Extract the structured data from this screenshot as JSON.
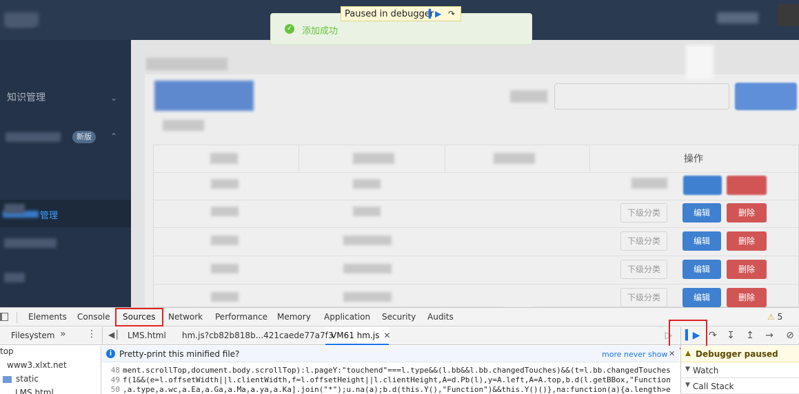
{
  "sidebar": {
    "knowledge_label": "知识管理",
    "new_tag": "新版",
    "sub_label": "管理"
  },
  "toast": {
    "message": "添加成功"
  },
  "debugger_banner": {
    "text": "Paused in debugger"
  },
  "table": {
    "op_header": "操作",
    "sub_button": "下级分类",
    "edit_button": "编辑",
    "delete_button": "删除"
  },
  "devtools": {
    "tabs": [
      "Elements",
      "Console",
      "Sources",
      "Network",
      "Performance",
      "Memory",
      "Application",
      "Security",
      "Audits"
    ],
    "warnings": "5",
    "filesystem_label": "Filesystem",
    "file_tabs": [
      "LMS.html",
      "hm.js?cb82b818b...421caede77a7f3",
      "VM61 hm.js"
    ],
    "tree": [
      "top",
      "www3.xlxt.net",
      "static",
      "LMS.html"
    ],
    "pretty_print": {
      "prompt": "Pretty-print this minified file?",
      "link": "more never show"
    },
    "code_lines": [
      {
        "n": "48",
        "text": "ment.scrollTop,document.body.scrollTop):l.pageY:\"touchend\"===l.type&&(l.bb&&l.bb.changedTouches)&&(t=l.bb.changedTouches"
      },
      {
        "n": "49",
        "text": "f(1&&(e=l.offsetWidth||l.clientWidth,f=l.offsetHeight||l.clientHeight,A=d.Pb(l),y=A.left,A=A.top,b.d(l.getBBox,\"Function"
      },
      {
        "n": "50",
        "text": ",a.type,a.wc,a.Ea,a.Ga,a.Ma,a.ya,a.Ka].join(\"*\");u.na(a);b.d(this.Y(),\"Function\")&&this.Y()()},na:function(a){a.length>e"
      }
    ],
    "right": {
      "paused": "Debugger paused",
      "watch": "Watch",
      "call_stack": "Call Stack"
    }
  }
}
